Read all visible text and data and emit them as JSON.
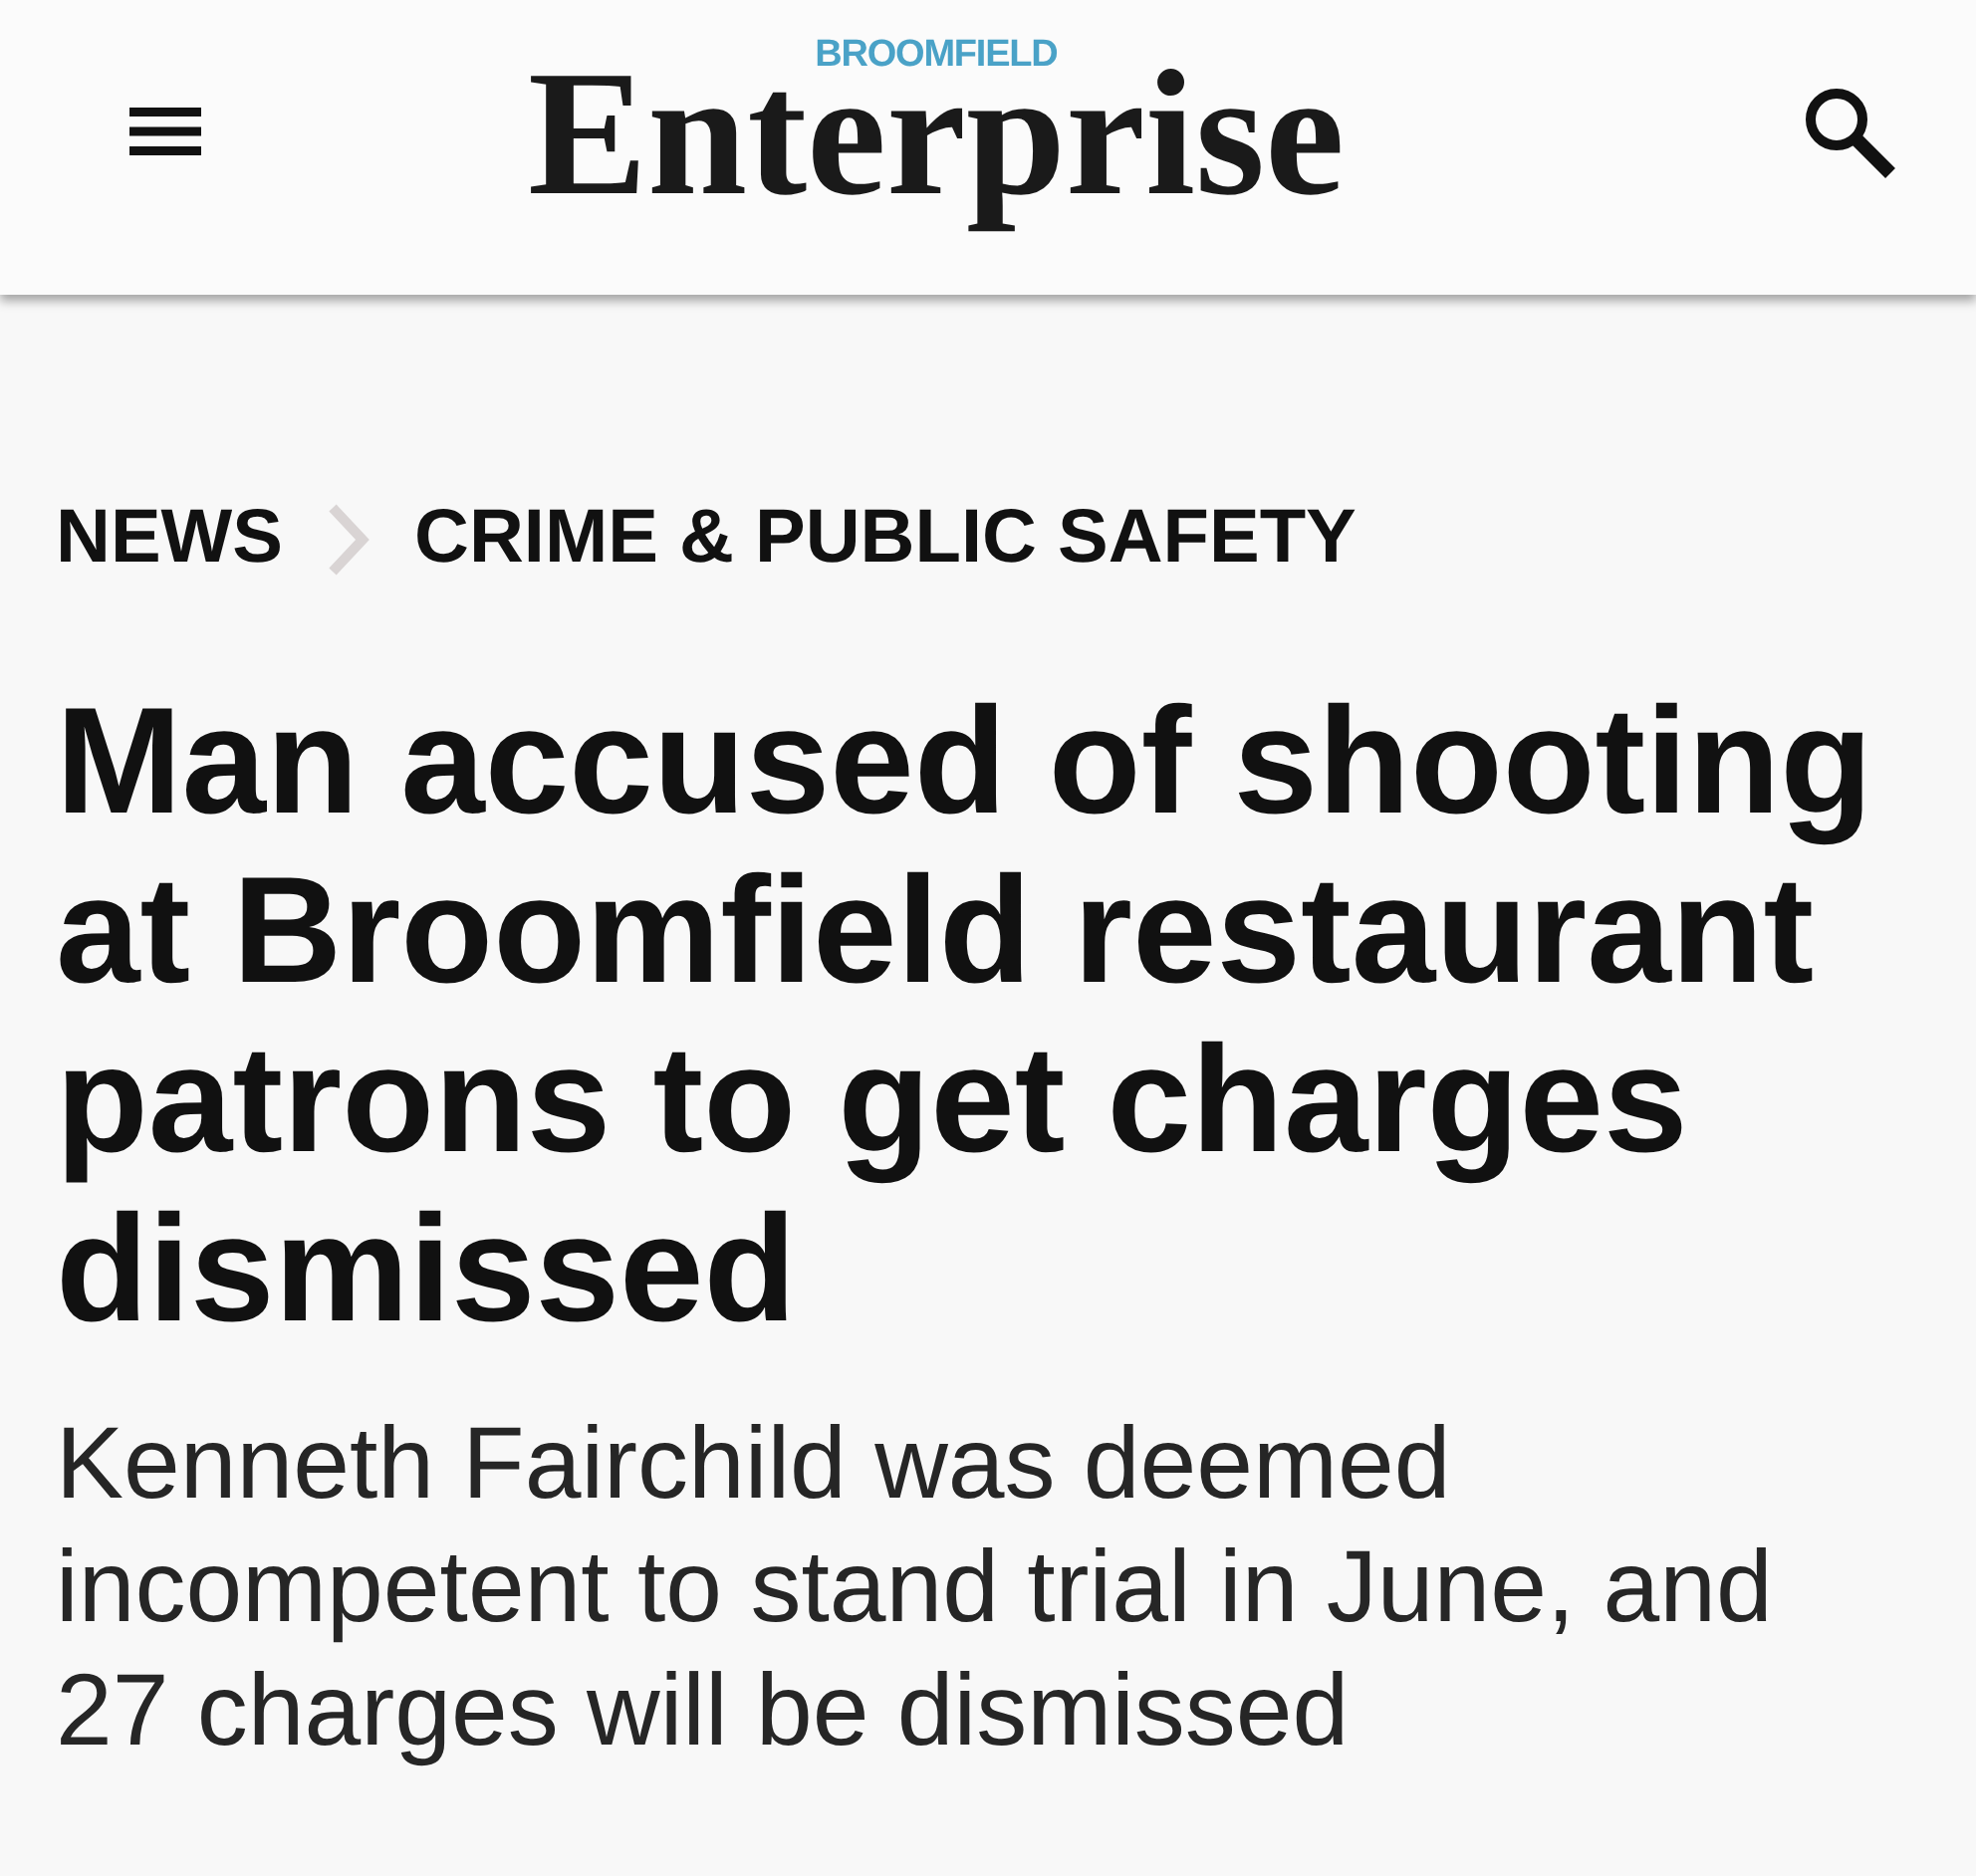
{
  "header": {
    "logo": {
      "kicker": "BROOMFIELD",
      "name": "Enterprise"
    }
  },
  "breadcrumb": [
    {
      "label": "NEWS"
    },
    {
      "label": "CRIME & PUBLIC SAFETY"
    }
  ],
  "article": {
    "headline": "Man accused of shooting at Broomfield restaurant patrons to get charges dismissed",
    "subheadline": "Kenneth Fairchild was deemed incompetent to stand trial in June, and 27 charges will be dismissed"
  }
}
